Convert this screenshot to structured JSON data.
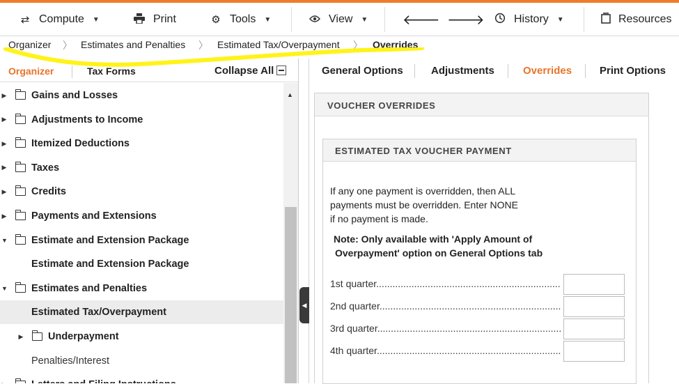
{
  "toolbar": {
    "compute": "Compute",
    "print": "Print",
    "tools": "Tools",
    "view": "View",
    "history": "History",
    "resources": "Resources"
  },
  "breadcrumb": [
    "Organizer",
    "Estimates and Penalties",
    "Estimated Tax/Overpayment",
    "Overrides"
  ],
  "left_tabs": {
    "organizer": "Organizer",
    "tax_forms": "Tax Forms",
    "collapse_all": "Collapse All"
  },
  "tree": [
    {
      "label": "Gains and Losses",
      "expanded": false,
      "folder": true
    },
    {
      "label": "Adjustments to Income",
      "expanded": false,
      "folder": true
    },
    {
      "label": "Itemized Deductions",
      "expanded": false,
      "folder": true
    },
    {
      "label": "Taxes",
      "expanded": false,
      "folder": true
    },
    {
      "label": "Credits",
      "expanded": false,
      "folder": true
    },
    {
      "label": "Payments and Extensions",
      "expanded": false,
      "folder": true
    },
    {
      "label": "Estimate and Extension Package",
      "expanded": true,
      "folder": true
    },
    {
      "label": "Estimate and Extension Package",
      "folder": false
    },
    {
      "label": "Estimates and Penalties",
      "expanded": true,
      "folder": true
    },
    {
      "label": "Estimated Tax/Overpayment",
      "folder": false,
      "selected": true
    },
    {
      "label": "Underpayment",
      "expanded": false,
      "folder": true
    },
    {
      "label": "Penalties/Interest",
      "folder": false
    },
    {
      "label": "Letters and Filing Instructions",
      "expanded": false,
      "folder": true
    }
  ],
  "right_tabs": [
    "General Options",
    "Adjustments",
    "Overrides",
    "Print Options"
  ],
  "active_right_tab": "Overrides",
  "panel": {
    "title": "VOUCHER OVERRIDES",
    "section_title": "ESTIMATED TAX VOUCHER PAYMENT",
    "description_lines": [
      "If any one payment is overridden, then ALL",
      "payments must be overridden. Enter NONE",
      "if no payment is made."
    ],
    "note_lines": [
      "Note: Only available with 'Apply Amount of",
      "Overpayment' option on General Options tab"
    ],
    "quarters": [
      {
        "label": "1st quarter",
        "value": ""
      },
      {
        "label": "2nd quarter",
        "value": ""
      },
      {
        "label": "3rd quarter",
        "value": ""
      },
      {
        "label": "4th quarter",
        "value": ""
      }
    ]
  },
  "colors": {
    "accent": "#e8742a",
    "highlight": "#fff200"
  }
}
